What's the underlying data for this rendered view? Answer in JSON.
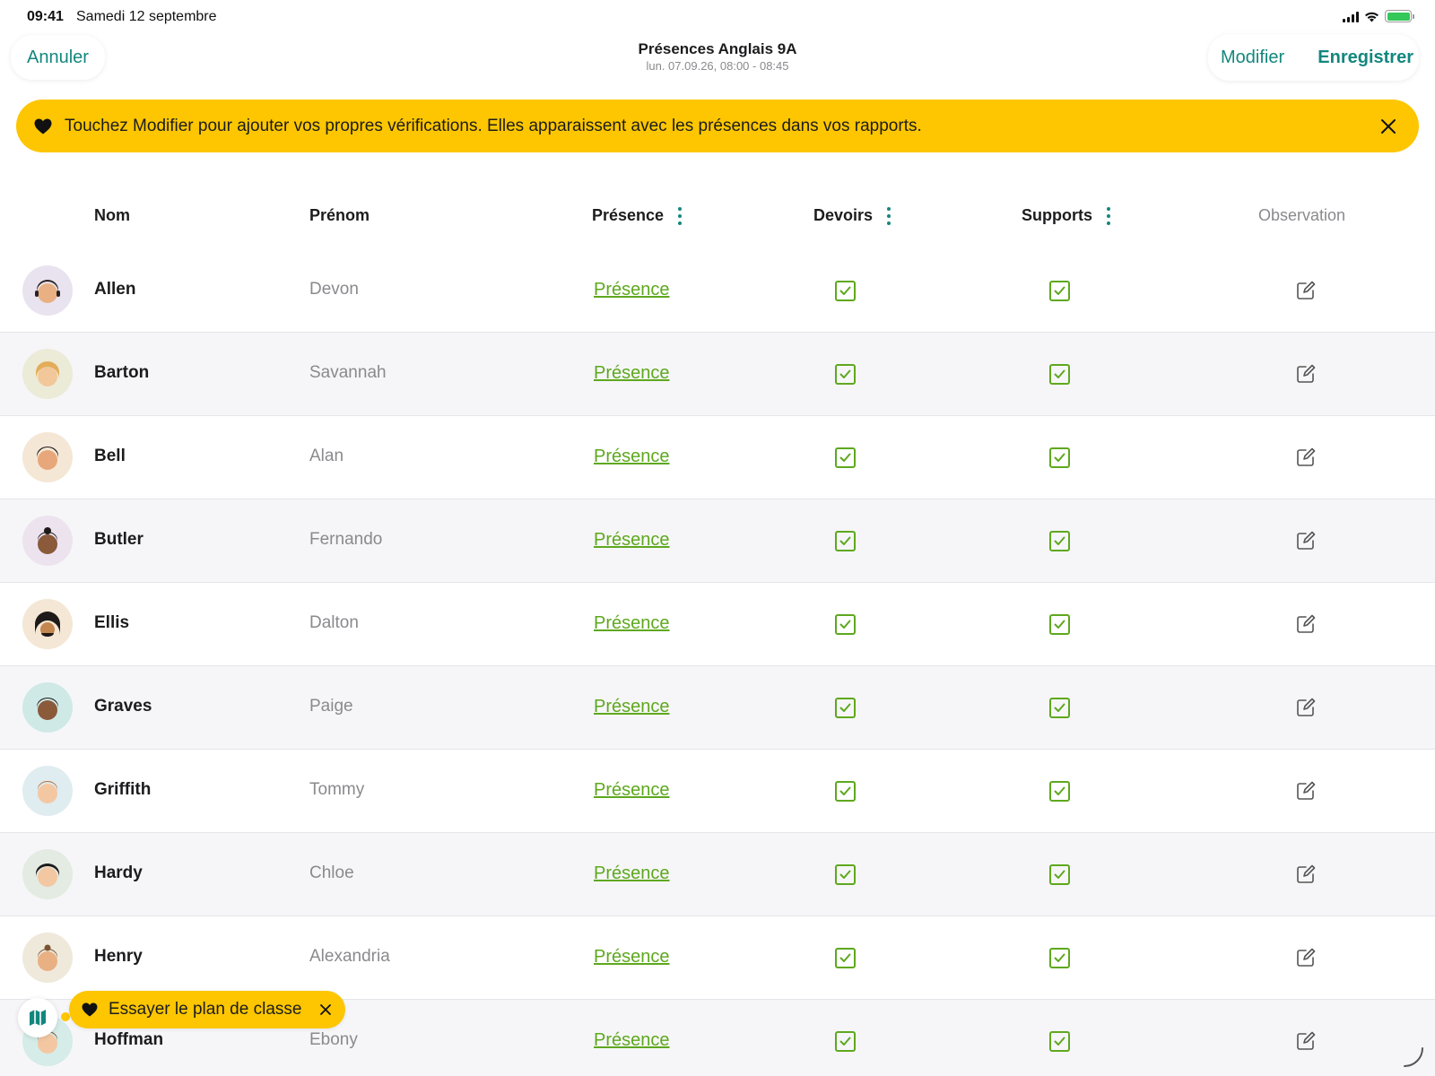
{
  "status_bar": {
    "time": "09:41",
    "date": "Samedi 12 septembre"
  },
  "nav": {
    "cancel_label": "Annuler",
    "title": "Présences Anglais 9A",
    "subtitle": "lun. 07.09.26, 08:00 - 08:45",
    "edit_label": "Modifier",
    "save_label": "Enregistrer"
  },
  "banner": {
    "text": "Touchez Modifier pour ajouter vos propres vérifications. Elles apparaissent avec les présences dans vos rapports."
  },
  "table": {
    "headers": {
      "nom": "Nom",
      "prenom": "Prénom",
      "presence": "Présence",
      "devoirs": "Devoirs",
      "supports": "Supports",
      "observation": "Observation"
    },
    "rows": [
      {
        "nom": "Allen",
        "prenom": "Devon",
        "presence": "Présence",
        "devoirs": true,
        "supports": true
      },
      {
        "nom": "Barton",
        "prenom": "Savannah",
        "presence": "Présence",
        "devoirs": true,
        "supports": true
      },
      {
        "nom": "Bell",
        "prenom": "Alan",
        "presence": "Présence",
        "devoirs": true,
        "supports": true
      },
      {
        "nom": "Butler",
        "prenom": "Fernando",
        "presence": "Présence",
        "devoirs": true,
        "supports": true
      },
      {
        "nom": "Ellis",
        "prenom": "Dalton",
        "presence": "Présence",
        "devoirs": true,
        "supports": true
      },
      {
        "nom": "Graves",
        "prenom": "Paige",
        "presence": "Présence",
        "devoirs": true,
        "supports": true
      },
      {
        "nom": "Griffith",
        "prenom": "Tommy",
        "presence": "Présence",
        "devoirs": true,
        "supports": true
      },
      {
        "nom": "Hardy",
        "prenom": "Chloe",
        "presence": "Présence",
        "devoirs": true,
        "supports": true
      },
      {
        "nom": "Henry",
        "prenom": "Alexandria",
        "presence": "Présence",
        "devoirs": true,
        "supports": true
      },
      {
        "nom": "Hoffman",
        "prenom": "Ebony",
        "presence": "Présence",
        "devoirs": true,
        "supports": true
      }
    ]
  },
  "floating": {
    "seating_plan_label": "Essayer le plan de classe"
  },
  "colors": {
    "accent": "#13877e",
    "presence_green": "#5ea81e",
    "banner_yellow": "#fdc600",
    "row_alt": "#f6f6f8"
  }
}
